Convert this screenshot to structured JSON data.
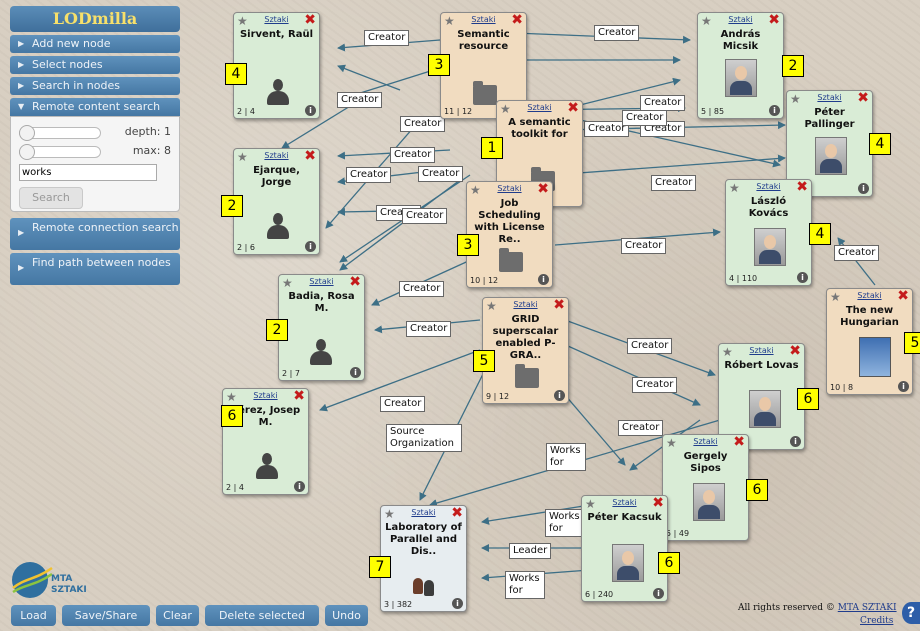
{
  "sidebar": {
    "logo": "LODmilla",
    "menu": [
      "Add new node",
      "Select nodes",
      "Search in nodes"
    ],
    "remote_search": {
      "label": "Remote content search",
      "depth_label": "depth: 1",
      "max_label": "max: 8",
      "query": "works",
      "search_button": "Search"
    },
    "remote_connection": "Remote connection search",
    "find_path": "Find path between nodes"
  },
  "bottom": {
    "load": "Load",
    "save": "Save/Share",
    "clear": "Clear",
    "delete": "Delete selected",
    "undo": "Undo"
  },
  "logo_mta": {
    "line1": "MTA",
    "line2": "SZTAKI"
  },
  "footer": {
    "rights": "All rights reserved ©",
    "link": "MTA SZTAKI",
    "credits": "Credits",
    "help": "?"
  },
  "colors": {
    "person": "#d9ecd6",
    "document": "#f1dcc0",
    "organization": "#e7edf0",
    "badge": "#ffff00",
    "menu": "#4f82ad",
    "edge": "#3d6f86"
  },
  "nodes": [
    {
      "id": "sirvent",
      "type": "person",
      "title": "Sirvent, Raül",
      "source": "Sztaki",
      "counts": "2 | 4",
      "badge": "4",
      "icon": "person-silhouette"
    },
    {
      "id": "semantic",
      "type": "doc",
      "title": "Semantic resource",
      "source": "Sztaki",
      "counts": "11 | 12",
      "badge": "3",
      "icon": "folder"
    },
    {
      "id": "micsik",
      "type": "person",
      "title": "András Micsik",
      "source": "Sztaki",
      "counts": "5 | 85",
      "badge": "2",
      "icon": "photo"
    },
    {
      "id": "toolkit",
      "type": "doc",
      "title": "A semantic toolkit for",
      "source": "Sztaki",
      "counts": "",
      "badge": "1",
      "icon": "folder"
    },
    {
      "id": "pallinger",
      "type": "person",
      "title": "Péter Pallinger",
      "source": "Sztaki",
      "counts": "",
      "badge": "4",
      "icon": "photo"
    },
    {
      "id": "ejarque",
      "type": "person",
      "title": "Ejarque, Jorge",
      "source": "Sztaki",
      "counts": "2 | 6",
      "badge": "2",
      "icon": "person-silhouette"
    },
    {
      "id": "jobsched",
      "type": "doc",
      "title": "Job Scheduling with License Re..",
      "source": "Sztaki",
      "counts": "10 | 12",
      "badge": "3",
      "icon": "folder"
    },
    {
      "id": "kovacs",
      "type": "person",
      "title": "László Kovács",
      "source": "Sztaki",
      "counts": "4 | 110",
      "badge": "4",
      "icon": "photo"
    },
    {
      "id": "badia",
      "type": "person",
      "title": "Badia, Rosa M.",
      "source": "Sztaki",
      "counts": "2 | 7",
      "badge": "2",
      "icon": "person-silhouette"
    },
    {
      "id": "grid",
      "type": "doc",
      "title": "GRID superscalar enabled P-GRA..",
      "source": "Sztaki",
      "counts": "9 | 12",
      "badge": "5",
      "icon": "folder"
    },
    {
      "id": "hungarian",
      "type": "doc",
      "title": "The new Hungarian",
      "source": "Sztaki",
      "counts": "10 | 8",
      "badge": "5",
      "icon": "book"
    },
    {
      "id": "lovas",
      "type": "person",
      "title": "Róbert Lovas",
      "source": "Sztaki",
      "counts": "",
      "badge": "6",
      "icon": "photo"
    },
    {
      "id": "perez",
      "type": "person",
      "title": "Pérez, Josep M.",
      "source": "Sztaki",
      "counts": "2 | 4",
      "badge": "6",
      "icon": "person-silhouette"
    },
    {
      "id": "sipos",
      "type": "person",
      "title": "Gergely Sipos",
      "source": "Sztaki",
      "counts": "5 | 49",
      "badge": "6",
      "icon": "photo"
    },
    {
      "id": "lab",
      "type": "org",
      "title": "Laboratory of Parallel and Dis..",
      "source": "Sztaki",
      "counts": "3 | 382",
      "badge": "7",
      "icon": "two-people"
    },
    {
      "id": "kacsuk",
      "type": "person",
      "title": "Péter Kacsuk",
      "source": "Sztaki",
      "counts": "6 | 240",
      "badge": "6",
      "icon": "photo"
    }
  ],
  "edge_labels": [
    "Creator",
    "Creator",
    "Creator",
    "Creator",
    "Creator",
    "Creator",
    "Creator",
    "Creator",
    "Creator",
    "Creator",
    "Creator",
    "Creator",
    "Creator",
    "Creator",
    "Creator",
    "Creator",
    "Creator",
    "Creator",
    "Creator",
    "Creator",
    "Creator",
    "Creator",
    "Source Organization",
    "Works for",
    "Works for",
    "Leader",
    "Works for"
  ]
}
